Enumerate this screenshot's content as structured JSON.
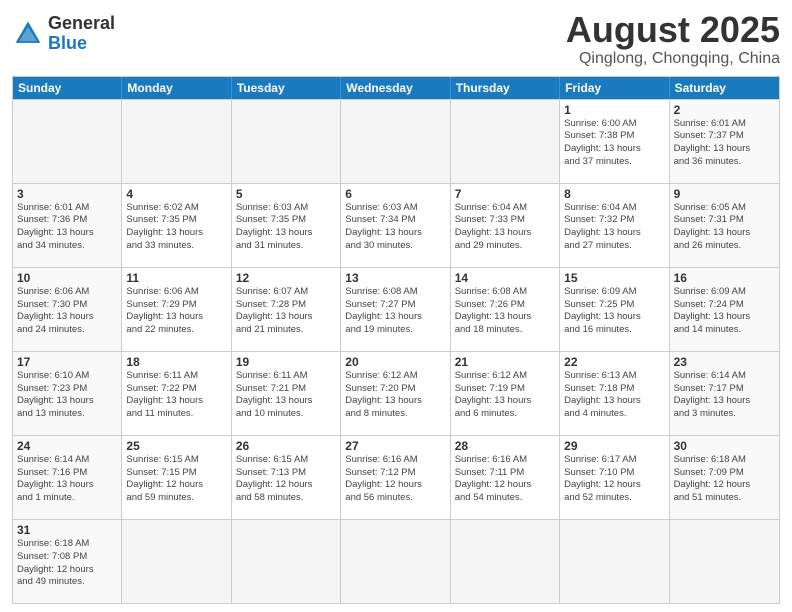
{
  "header": {
    "logo_general": "General",
    "logo_blue": "Blue",
    "title": "August 2025",
    "subtitle": "Qinglong, Chongqing, China"
  },
  "days_of_week": [
    "Sunday",
    "Monday",
    "Tuesday",
    "Wednesday",
    "Thursday",
    "Friday",
    "Saturday"
  ],
  "weeks": [
    [
      {
        "day": "",
        "info": "",
        "empty": true
      },
      {
        "day": "",
        "info": "",
        "empty": true
      },
      {
        "day": "",
        "info": "",
        "empty": true
      },
      {
        "day": "",
        "info": "",
        "empty": true
      },
      {
        "day": "",
        "info": "",
        "empty": true
      },
      {
        "day": "1",
        "info": "Sunrise: 6:00 AM\nSunset: 7:38 PM\nDaylight: 13 hours\nand 37 minutes."
      },
      {
        "day": "2",
        "info": "Sunrise: 6:01 AM\nSunset: 7:37 PM\nDaylight: 13 hours\nand 36 minutes."
      }
    ],
    [
      {
        "day": "3",
        "info": "Sunrise: 6:01 AM\nSunset: 7:36 PM\nDaylight: 13 hours\nand 34 minutes."
      },
      {
        "day": "4",
        "info": "Sunrise: 6:02 AM\nSunset: 7:35 PM\nDaylight: 13 hours\nand 33 minutes."
      },
      {
        "day": "5",
        "info": "Sunrise: 6:03 AM\nSunset: 7:35 PM\nDaylight: 13 hours\nand 31 minutes."
      },
      {
        "day": "6",
        "info": "Sunrise: 6:03 AM\nSunset: 7:34 PM\nDaylight: 13 hours\nand 30 minutes."
      },
      {
        "day": "7",
        "info": "Sunrise: 6:04 AM\nSunset: 7:33 PM\nDaylight: 13 hours\nand 29 minutes."
      },
      {
        "day": "8",
        "info": "Sunrise: 6:04 AM\nSunset: 7:32 PM\nDaylight: 13 hours\nand 27 minutes."
      },
      {
        "day": "9",
        "info": "Sunrise: 6:05 AM\nSunset: 7:31 PM\nDaylight: 13 hours\nand 26 minutes."
      }
    ],
    [
      {
        "day": "10",
        "info": "Sunrise: 6:06 AM\nSunset: 7:30 PM\nDaylight: 13 hours\nand 24 minutes."
      },
      {
        "day": "11",
        "info": "Sunrise: 6:06 AM\nSunset: 7:29 PM\nDaylight: 13 hours\nand 22 minutes."
      },
      {
        "day": "12",
        "info": "Sunrise: 6:07 AM\nSunset: 7:28 PM\nDaylight: 13 hours\nand 21 minutes."
      },
      {
        "day": "13",
        "info": "Sunrise: 6:08 AM\nSunset: 7:27 PM\nDaylight: 13 hours\nand 19 minutes."
      },
      {
        "day": "14",
        "info": "Sunrise: 6:08 AM\nSunset: 7:26 PM\nDaylight: 13 hours\nand 18 minutes."
      },
      {
        "day": "15",
        "info": "Sunrise: 6:09 AM\nSunset: 7:25 PM\nDaylight: 13 hours\nand 16 minutes."
      },
      {
        "day": "16",
        "info": "Sunrise: 6:09 AM\nSunset: 7:24 PM\nDaylight: 13 hours\nand 14 minutes."
      }
    ],
    [
      {
        "day": "17",
        "info": "Sunrise: 6:10 AM\nSunset: 7:23 PM\nDaylight: 13 hours\nand 13 minutes."
      },
      {
        "day": "18",
        "info": "Sunrise: 6:11 AM\nSunset: 7:22 PM\nDaylight: 13 hours\nand 11 minutes."
      },
      {
        "day": "19",
        "info": "Sunrise: 6:11 AM\nSunset: 7:21 PM\nDaylight: 13 hours\nand 10 minutes."
      },
      {
        "day": "20",
        "info": "Sunrise: 6:12 AM\nSunset: 7:20 PM\nDaylight: 13 hours\nand 8 minutes."
      },
      {
        "day": "21",
        "info": "Sunrise: 6:12 AM\nSunset: 7:19 PM\nDaylight: 13 hours\nand 6 minutes."
      },
      {
        "day": "22",
        "info": "Sunrise: 6:13 AM\nSunset: 7:18 PM\nDaylight: 13 hours\nand 4 minutes."
      },
      {
        "day": "23",
        "info": "Sunrise: 6:14 AM\nSunset: 7:17 PM\nDaylight: 13 hours\nand 3 minutes."
      }
    ],
    [
      {
        "day": "24",
        "info": "Sunrise: 6:14 AM\nSunset: 7:16 PM\nDaylight: 13 hours\nand 1 minute."
      },
      {
        "day": "25",
        "info": "Sunrise: 6:15 AM\nSunset: 7:15 PM\nDaylight: 12 hours\nand 59 minutes."
      },
      {
        "day": "26",
        "info": "Sunrise: 6:15 AM\nSunset: 7:13 PM\nDaylight: 12 hours\nand 58 minutes."
      },
      {
        "day": "27",
        "info": "Sunrise: 6:16 AM\nSunset: 7:12 PM\nDaylight: 12 hours\nand 56 minutes."
      },
      {
        "day": "28",
        "info": "Sunrise: 6:16 AM\nSunset: 7:11 PM\nDaylight: 12 hours\nand 54 minutes."
      },
      {
        "day": "29",
        "info": "Sunrise: 6:17 AM\nSunset: 7:10 PM\nDaylight: 12 hours\nand 52 minutes."
      },
      {
        "day": "30",
        "info": "Sunrise: 6:18 AM\nSunset: 7:09 PM\nDaylight: 12 hours\nand 51 minutes."
      }
    ],
    [
      {
        "day": "31",
        "info": "Sunrise: 6:18 AM\nSunset: 7:08 PM\nDaylight: 12 hours\nand 49 minutes."
      },
      {
        "day": "",
        "info": "",
        "empty": true
      },
      {
        "day": "",
        "info": "",
        "empty": true
      },
      {
        "day": "",
        "info": "",
        "empty": true
      },
      {
        "day": "",
        "info": "",
        "empty": true
      },
      {
        "day": "",
        "info": "",
        "empty": true
      },
      {
        "day": "",
        "info": "",
        "empty": true
      }
    ]
  ]
}
